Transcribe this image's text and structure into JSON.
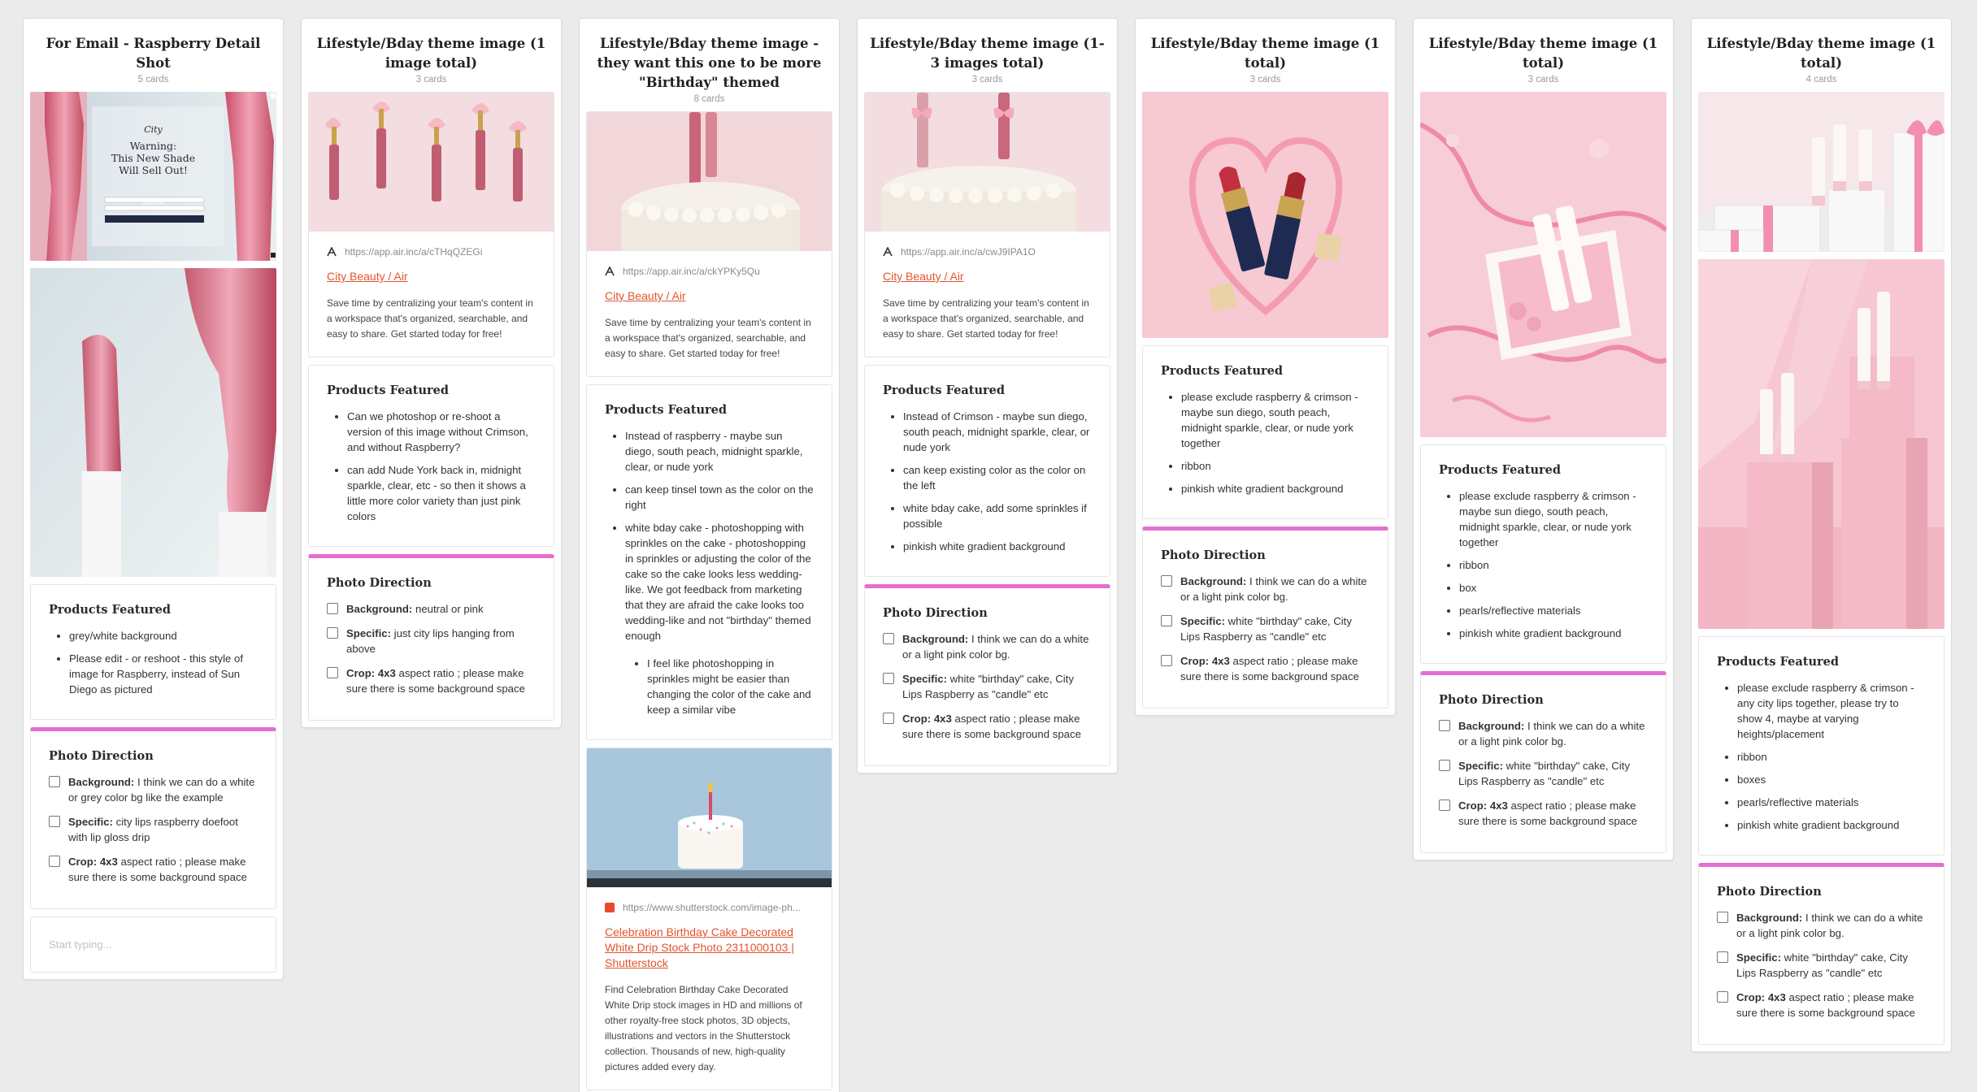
{
  "columns": [
    {
      "title": "For Email - Raspberry Detail Shot",
      "count": "5 cards",
      "email_overlay": {
        "brand": "City",
        "headline_1": "Warning:",
        "headline_2": "This New Shade",
        "headline_3": "Will Sell Out!",
        "button": "SHOP NOW"
      },
      "products": {
        "title": "Products Featured",
        "items": [
          "grey/white background",
          "Please edit - or reshoot - this style of image for Raspberry, instead of Sun Diego as pictured"
        ]
      },
      "direction": {
        "title": "Photo Direction",
        "items": [
          {
            "label": "Background:",
            "text": " I think we can do a white or grey color bg like the example"
          },
          {
            "label": "Specific:",
            "text": " city lips raspberry doefoot with lip gloss drip"
          },
          {
            "label": "Crop: 4x3",
            "text": " aspect ratio ; please make sure there is some background space"
          }
        ]
      },
      "typing_placeholder": "Start typing..."
    },
    {
      "title": "Lifestyle/Bday theme image (1 image total)",
      "count": "3 cards",
      "link": {
        "url": "https://app.air.inc/a/cTHqQZEGi",
        "title": "City Beauty / Air",
        "desc": "Save time by centralizing your team's content in a workspace that's organized, searchable, and easy to share. Get started today for free!"
      },
      "products": {
        "title": "Products Featured",
        "items": [
          "Can we photoshop or re-shoot a version of this image without Crimson, and without Raspberry?",
          "can add Nude York back in, midnight sparkle, clear, etc - so then it shows a little more color variety than just pink colors"
        ]
      },
      "direction": {
        "title": "Photo Direction",
        "items": [
          {
            "label": "Background:",
            "text": " neutral or pink"
          },
          {
            "label": "Specific:",
            "text": " just city lips hanging from above"
          },
          {
            "label": "Crop: 4x3",
            "text": " aspect ratio ; please make sure there is some background space"
          }
        ]
      }
    },
    {
      "title": "Lifestyle/Bday theme image  - they want this one to be more \"Birthday\" themed",
      "count": "8 cards",
      "link": {
        "url": "https://app.air.inc/a/ckYPKy5Qu",
        "title": "City Beauty / Air",
        "desc": "Save time by centralizing your team's content in a workspace that's organized, searchable, and easy to share. Get started today for free!"
      },
      "products": {
        "title": "Products Featured",
        "items": [
          "Instead of raspberry - maybe sun diego, south peach, midnight sparkle, clear, or nude york",
          "can keep tinsel town as the color on the right",
          "white bday cake - photoshopping with sprinkles on the cake - photoshopping in sprinkles or adjusting the color of the cake so the cake looks less wedding-like. We got feedback from marketing that they are afraid the cake looks too wedding-like and not \"birthday\" themed enough"
        ],
        "sub_items": [
          "I feel like photoshopping in sprinkles might be easier than changing the color of the cake and keep a similar vibe"
        ]
      },
      "link2": {
        "url": "https://www.shutterstock.com/image-ph...",
        "title": "Celebration Birthday Cake Decorated White Drip Stock Photo 2311000103 | Shutterstock",
        "desc": "Find Celebration Birthday Cake Decorated White Drip stock images in HD and millions of other royalty-free stock photos, 3D objects, illustrations and vectors in the Shutterstock collection.  Thousands of new, high-quality pictures added every day."
      }
    },
    {
      "title": "Lifestyle/Bday theme image (1-3 images total)",
      "count": "3 cards",
      "link": {
        "url": "https://app.air.inc/a/cwJ9IPA1O",
        "title": "City Beauty / Air",
        "desc": "Save time by centralizing your team's content in a workspace that's organized, searchable, and easy to share. Get started today for free!"
      },
      "products": {
        "title": "Products Featured",
        "items": [
          "Instead of Crimson - maybe sun diego, south peach, midnight sparkle, clear, or nude york",
          "can keep existing color as the color on the left",
          "white bday cake, add some sprinkles if possible",
          "pinkish white gradient background"
        ]
      },
      "direction": {
        "title": "Photo Direction",
        "items": [
          {
            "label": "Background:",
            "text": " I think we can do a white or a light pink color bg."
          },
          {
            "label": "Specific:",
            "text": " white \"birthday\" cake, City Lips Raspberry as \"candle\" etc"
          },
          {
            "label": "Crop: 4x3",
            "text": " aspect ratio ; please make sure there is some background space"
          }
        ]
      }
    },
    {
      "title": "Lifestyle/Bday theme image (1 total)",
      "count": "3 cards",
      "products": {
        "title": "Products Featured",
        "items": [
          "please exclude raspberry & crimson - maybe sun diego, south peach, midnight sparkle, clear, or nude york together",
          "ribbon",
          "pinkish white gradient background"
        ]
      },
      "direction": {
        "title": "Photo Direction",
        "items": [
          {
            "label": "Background:",
            "text": " I think we can do a white or a light pink color bg."
          },
          {
            "label": "Specific:",
            "text": " white \"birthday\" cake, City Lips Raspberry as \"candle\" etc"
          },
          {
            "label": "Crop: 4x3",
            "text": " aspect ratio ; please make sure there is some background space"
          }
        ]
      }
    },
    {
      "title": "Lifestyle/Bday theme image (1 total)",
      "count": "3 cards",
      "products": {
        "title": "Products Featured",
        "items": [
          "please exclude raspberry & crimson - maybe sun diego, south peach, midnight sparkle, clear, or nude york together",
          "ribbon",
          "box",
          "pearls/reflective materials",
          "pinkish white gradient background"
        ]
      },
      "direction": {
        "title": "Photo Direction",
        "items": [
          {
            "label": "Background:",
            "text": " I think we can do a white or a light pink color bg."
          },
          {
            "label": "Specific:",
            "text": " white \"birthday\" cake, City Lips Raspberry as \"candle\" etc"
          },
          {
            "label": "Crop: 4x3",
            "text": " aspect ratio ; please make sure there is some background space"
          }
        ]
      }
    },
    {
      "title": "Lifestyle/Bday theme image (1 total)",
      "count": "4 cards",
      "products": {
        "title": "Products Featured",
        "items": [
          "please exclude raspberry & crimson - any city lips together, please try to show 4, maybe at varying heights/placement",
          "ribbon",
          "boxes",
          "pearls/reflective materials",
          "pinkish white gradient background"
        ]
      },
      "direction": {
        "title": "Photo Direction",
        "items": [
          {
            "label": "Background:",
            "text": " I think we can do a white or a light pink color bg."
          },
          {
            "label": "Specific:",
            "text": " white \"birthday\" cake, City Lips Raspberry as \"candle\" etc"
          },
          {
            "label": "Crop: 4x3",
            "text": " aspect ratio ; please make sure there is some background space"
          }
        ]
      }
    }
  ],
  "colors": {
    "board_bg": "#ebebeb",
    "divider_accent": "#e46fd0",
    "link": "#e2542e"
  },
  "icons": {
    "air_link": "air-logo-icon",
    "shutterstock_link": "shutterstock-favicon-icon"
  }
}
